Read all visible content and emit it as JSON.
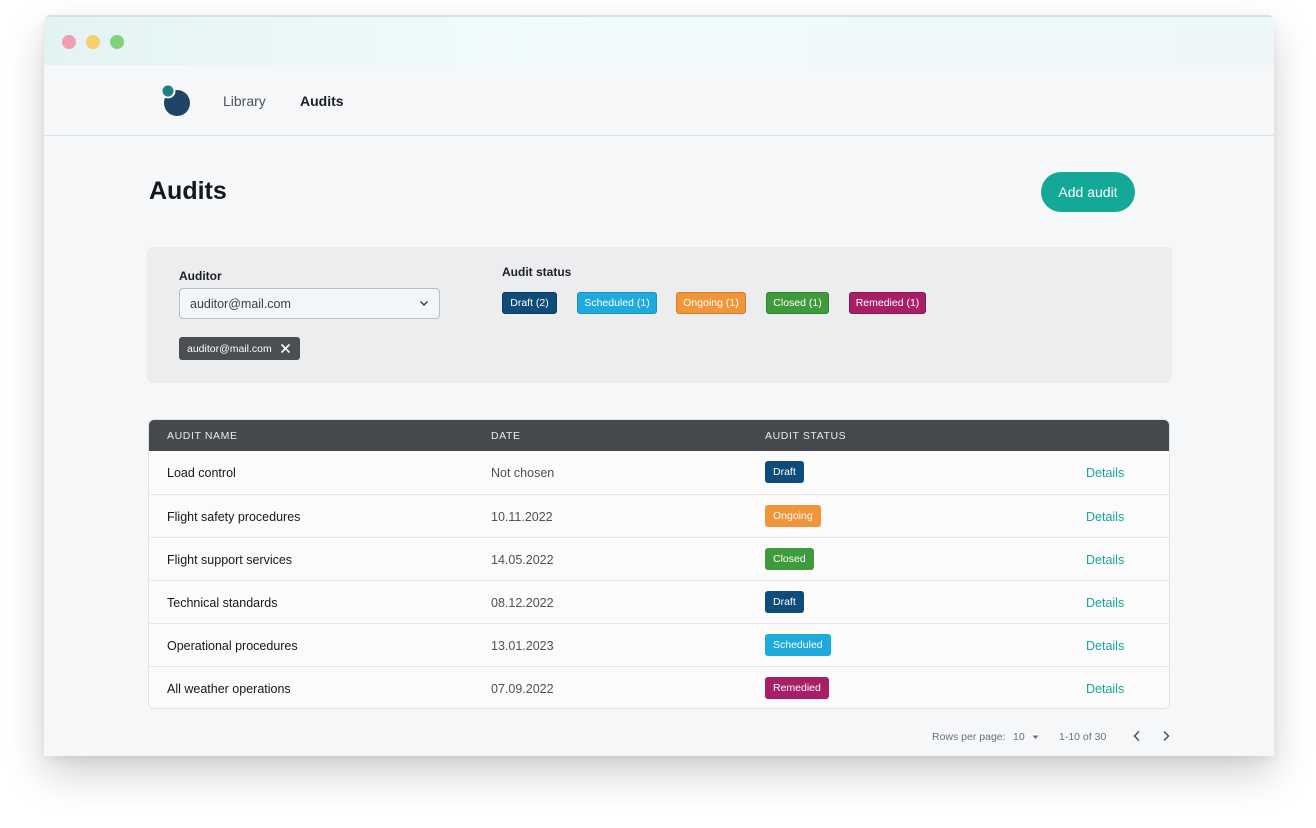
{
  "nav": {
    "items": [
      {
        "label": "Library"
      },
      {
        "label": "Audits"
      }
    ]
  },
  "page": {
    "title": "Audits",
    "add_button": "Add audit"
  },
  "filters": {
    "auditor_label": "Auditor",
    "auditor_value": "auditor@mail.com",
    "selected_chip": "auditor@mail.com",
    "status_label": "Audit status",
    "statuses": [
      {
        "label": "Draft (2)",
        "color": "#0e4c7a"
      },
      {
        "label": "Scheduled (1)",
        "color": "#1eaadb"
      },
      {
        "label": "Ongoing (1)",
        "color": "#f1953a"
      },
      {
        "label": "Closed (1)",
        "color": "#3e9a3a"
      },
      {
        "label": "Remedied (1)",
        "color": "#a91f66"
      }
    ]
  },
  "table": {
    "headers": [
      "AUDIT NAME",
      "DATE",
      "AUDIT STATUS"
    ],
    "rows": [
      {
        "name": "Load control",
        "date": "Not chosen",
        "status": "Draft",
        "status_color": "#0e4c7a",
        "link": "Details"
      },
      {
        "name": "Flight safety procedures",
        "date": "10.11.2022",
        "status": "Ongoing",
        "status_color": "#f1953a",
        "link": "Details"
      },
      {
        "name": "Flight support services",
        "date": "14.05.2022",
        "status": "Closed",
        "status_color": "#3e9a3a",
        "link": "Details"
      },
      {
        "name": "Technical standards",
        "date": "08.12.2022",
        "status": "Draft",
        "status_color": "#0e4c7a",
        "link": "Details"
      },
      {
        "name": "Operational procedures",
        "date": "13.01.2023",
        "status": "Scheduled",
        "status_color": "#1eaadb",
        "link": "Details"
      },
      {
        "name": "All weather operations",
        "date": "07.09.2022",
        "status": "Remedied",
        "status_color": "#a91f66",
        "link": "Details"
      }
    ]
  },
  "pagination": {
    "rows_per_page_label": "Rows per page:",
    "rows_per_page_value": "10",
    "range": "1-10 of 30"
  },
  "icons": {
    "logo": "logo-icon",
    "select_chevron": "chevron-down-icon",
    "chip_remove": "close-icon",
    "rows_caret": "caret-down-icon",
    "prev": "chevron-left-icon",
    "next": "chevron-right-icon"
  }
}
